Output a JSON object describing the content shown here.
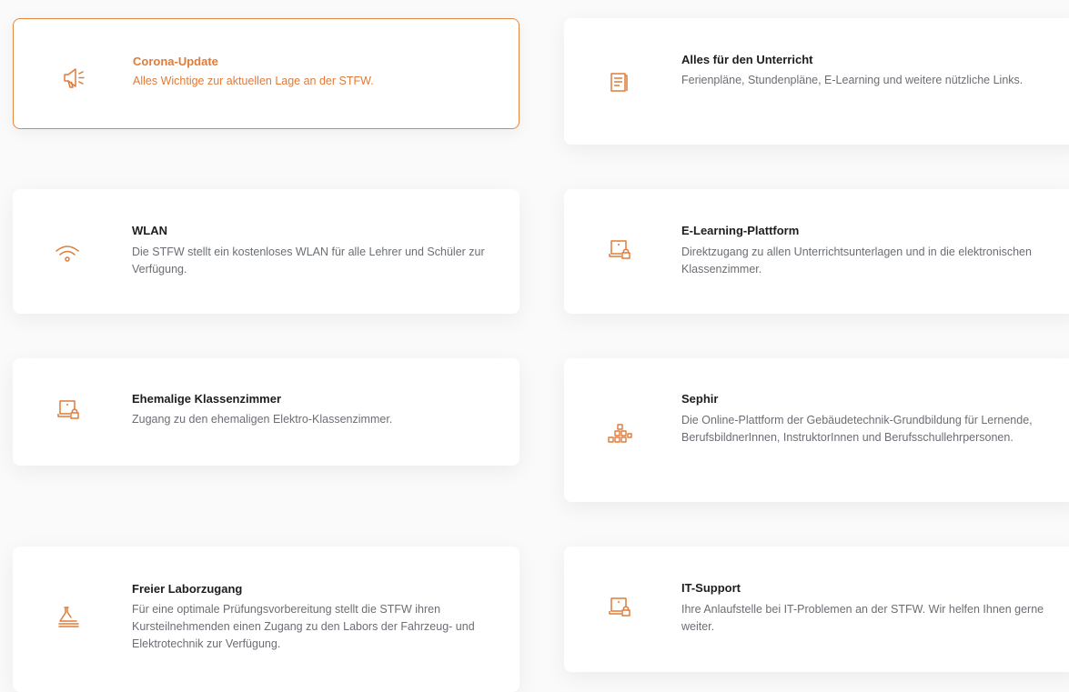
{
  "accent_color": "#e07b39",
  "cards": [
    {
      "icon": "megaphone-icon",
      "title": "Corona-Update",
      "description": "Alles Wichtige zur aktuellen Lage an der STFW."
    },
    {
      "icon": "document-icon",
      "title": "Alles für den Unterricht",
      "description": "Ferienpläne, Stundenpläne, E-Learning und weitere nützliche Links."
    },
    {
      "icon": "wifi-icon",
      "title": "WLAN",
      "description": "Die STFW stellt ein kostenloses WLAN für alle Lehrer und Schüler zur Verfügung."
    },
    {
      "icon": "laptop-lock-icon",
      "title": "E-Learning-Plattform",
      "description": "Direktzugang zu allen Unterrichtsunterlagen und in die elektronischen Klassenzimmer."
    },
    {
      "icon": "laptop-lock-icon",
      "title": "Ehemalige Klassenzimmer",
      "description": "Zugang zu den ehemaligen Elektro-Klassenzimmer."
    },
    {
      "icon": "blocks-icon",
      "title": "Sephir",
      "description": "Die Online-Plattform der Gebäudetechnik-Grundbildung für Lernende, BerufsbildnerInnen, InstruktorInnen und Berufsschullehrpersonen."
    },
    {
      "icon": "lab-icon",
      "title": "Freier Laborzugang",
      "description": "Für eine optimale Prüfungsvorbereitung stellt die STFW ihren Kursteilnehmenden einen Zugang zu den Labors der Fahrzeug- und Elektrotechnik zur Verfügung."
    },
    {
      "icon": "laptop-lock-icon",
      "title": "IT-Support",
      "description": "Ihre Anlaufstelle bei IT-Problemen an der STFW. Wir helfen Ihnen gerne weiter."
    }
  ]
}
